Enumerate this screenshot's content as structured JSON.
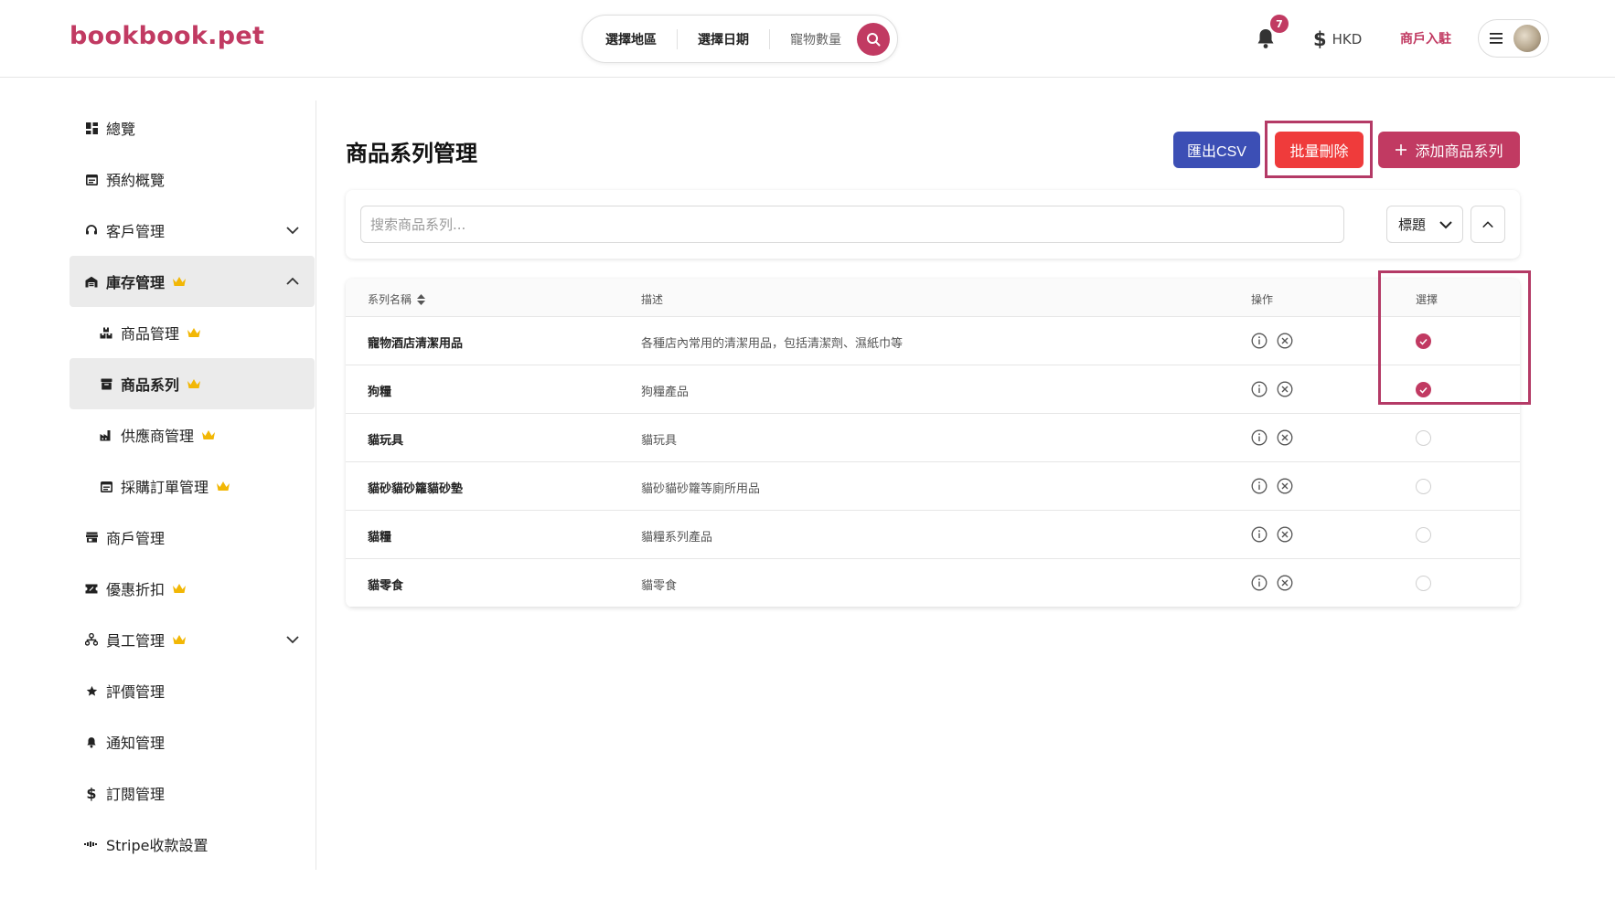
{
  "header": {
    "logo": "bookbook.pet",
    "search": {
      "region": "選擇地區",
      "date": "選擇日期",
      "pets": "寵物數量"
    },
    "notification_count": "7",
    "currency": "HKD",
    "merchant_link": "商戶入駐"
  },
  "sidebar": {
    "items": [
      {
        "label": "總覽"
      },
      {
        "label": "預約概覽"
      },
      {
        "label": "客戶管理"
      },
      {
        "label": "庫存管理"
      },
      {
        "label": "商品管理"
      },
      {
        "label": "商品系列"
      },
      {
        "label": "供應商管理"
      },
      {
        "label": "採購訂單管理"
      },
      {
        "label": "商戶管理"
      },
      {
        "label": "優惠折扣"
      },
      {
        "label": "員工管理"
      },
      {
        "label": "評價管理"
      },
      {
        "label": "通知管理"
      },
      {
        "label": "訂閱管理"
      },
      {
        "label": "Stripe收款設置"
      }
    ]
  },
  "main": {
    "title": "商品系列管理",
    "buttons": {
      "export_csv": "匯出CSV",
      "bulk_delete": "批量刪除",
      "add_series": "添加商品系列"
    },
    "filter": {
      "search_placeholder": "搜索商品系列...",
      "sort_field": "標題"
    },
    "table": {
      "headers": {
        "name": "系列名稱",
        "description": "描述",
        "actions": "操作",
        "select": "選擇"
      },
      "rows": [
        {
          "name": "寵物酒店清潔用品",
          "description": "各種店內常用的清潔用品，包括清潔劑、濕紙巾等",
          "selected": true
        },
        {
          "name": "狗糧",
          "description": "狗糧產品",
          "selected": true
        },
        {
          "name": "貓玩具",
          "description": "貓玩具",
          "selected": false
        },
        {
          "name": "貓砂貓砂籮貓砂墊",
          "description": "貓砂貓砂籮等廁所用品",
          "selected": false
        },
        {
          "name": "貓糧",
          "description": "貓糧系列產品",
          "selected": false
        },
        {
          "name": "貓零食",
          "description": "貓零食",
          "selected": false
        }
      ]
    }
  },
  "colors": {
    "brand": "#c13a62",
    "export_button": "#3c4fb5",
    "delete_button": "#ef3b3b",
    "highlight": "#b43a66",
    "crown": "#f2b705"
  }
}
